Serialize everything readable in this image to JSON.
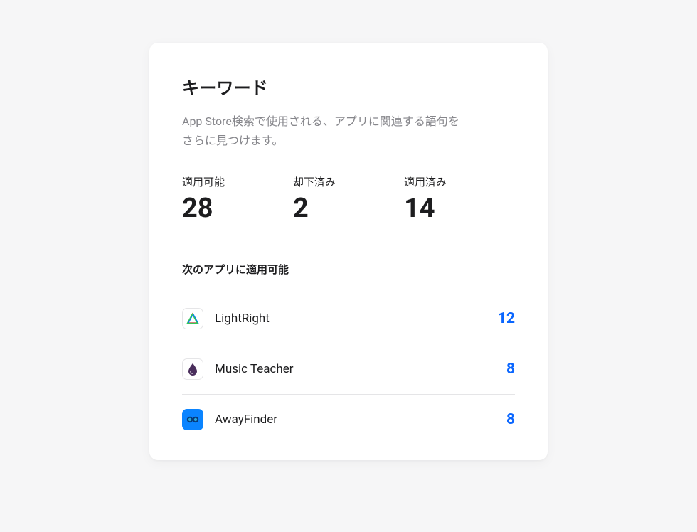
{
  "card": {
    "title": "キーワード",
    "description": "App Store検索で使用される、アプリに関連する語句をさらに見つけます。",
    "stats": [
      {
        "label": "適用可能",
        "value": "28"
      },
      {
        "label": "却下済み",
        "value": "2"
      },
      {
        "label": "適用済み",
        "value": "14"
      }
    ],
    "subheading": "次のアプリに適用可能",
    "apps": [
      {
        "name": "LightRight",
        "count": "12",
        "icon": "lightright"
      },
      {
        "name": "Music Teacher",
        "count": "8",
        "icon": "music"
      },
      {
        "name": "AwayFinder",
        "count": "8",
        "icon": "away"
      }
    ]
  }
}
